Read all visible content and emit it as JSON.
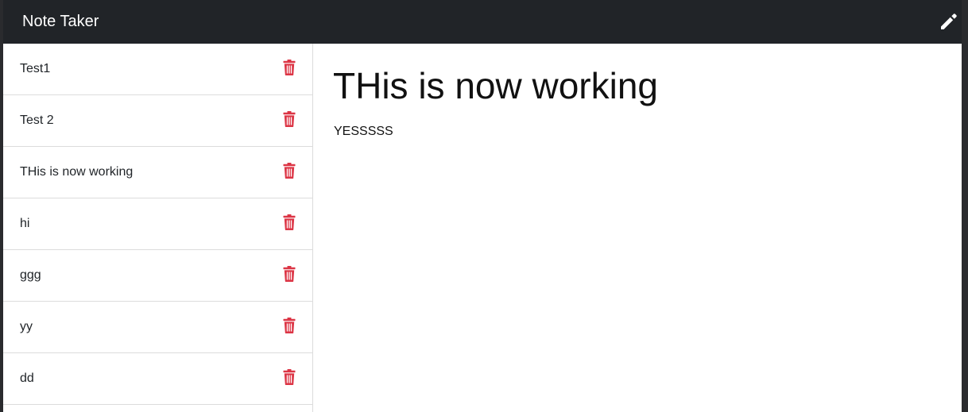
{
  "app": {
    "title": "Note Taker"
  },
  "notes": [
    {
      "title": "Test1"
    },
    {
      "title": "Test 2"
    },
    {
      "title": "THis is now working"
    },
    {
      "title": "hi"
    },
    {
      "title": "ggg"
    },
    {
      "title": "yy"
    },
    {
      "title": "dd"
    }
  ],
  "active_note": {
    "title": "THis is now working",
    "text": "YESSSSS"
  },
  "icons": {
    "new_note": "pencil-icon",
    "delete": "trash-icon"
  },
  "colors": {
    "navbar": "#212428",
    "delete": "#dc3545",
    "text": "#212529"
  }
}
